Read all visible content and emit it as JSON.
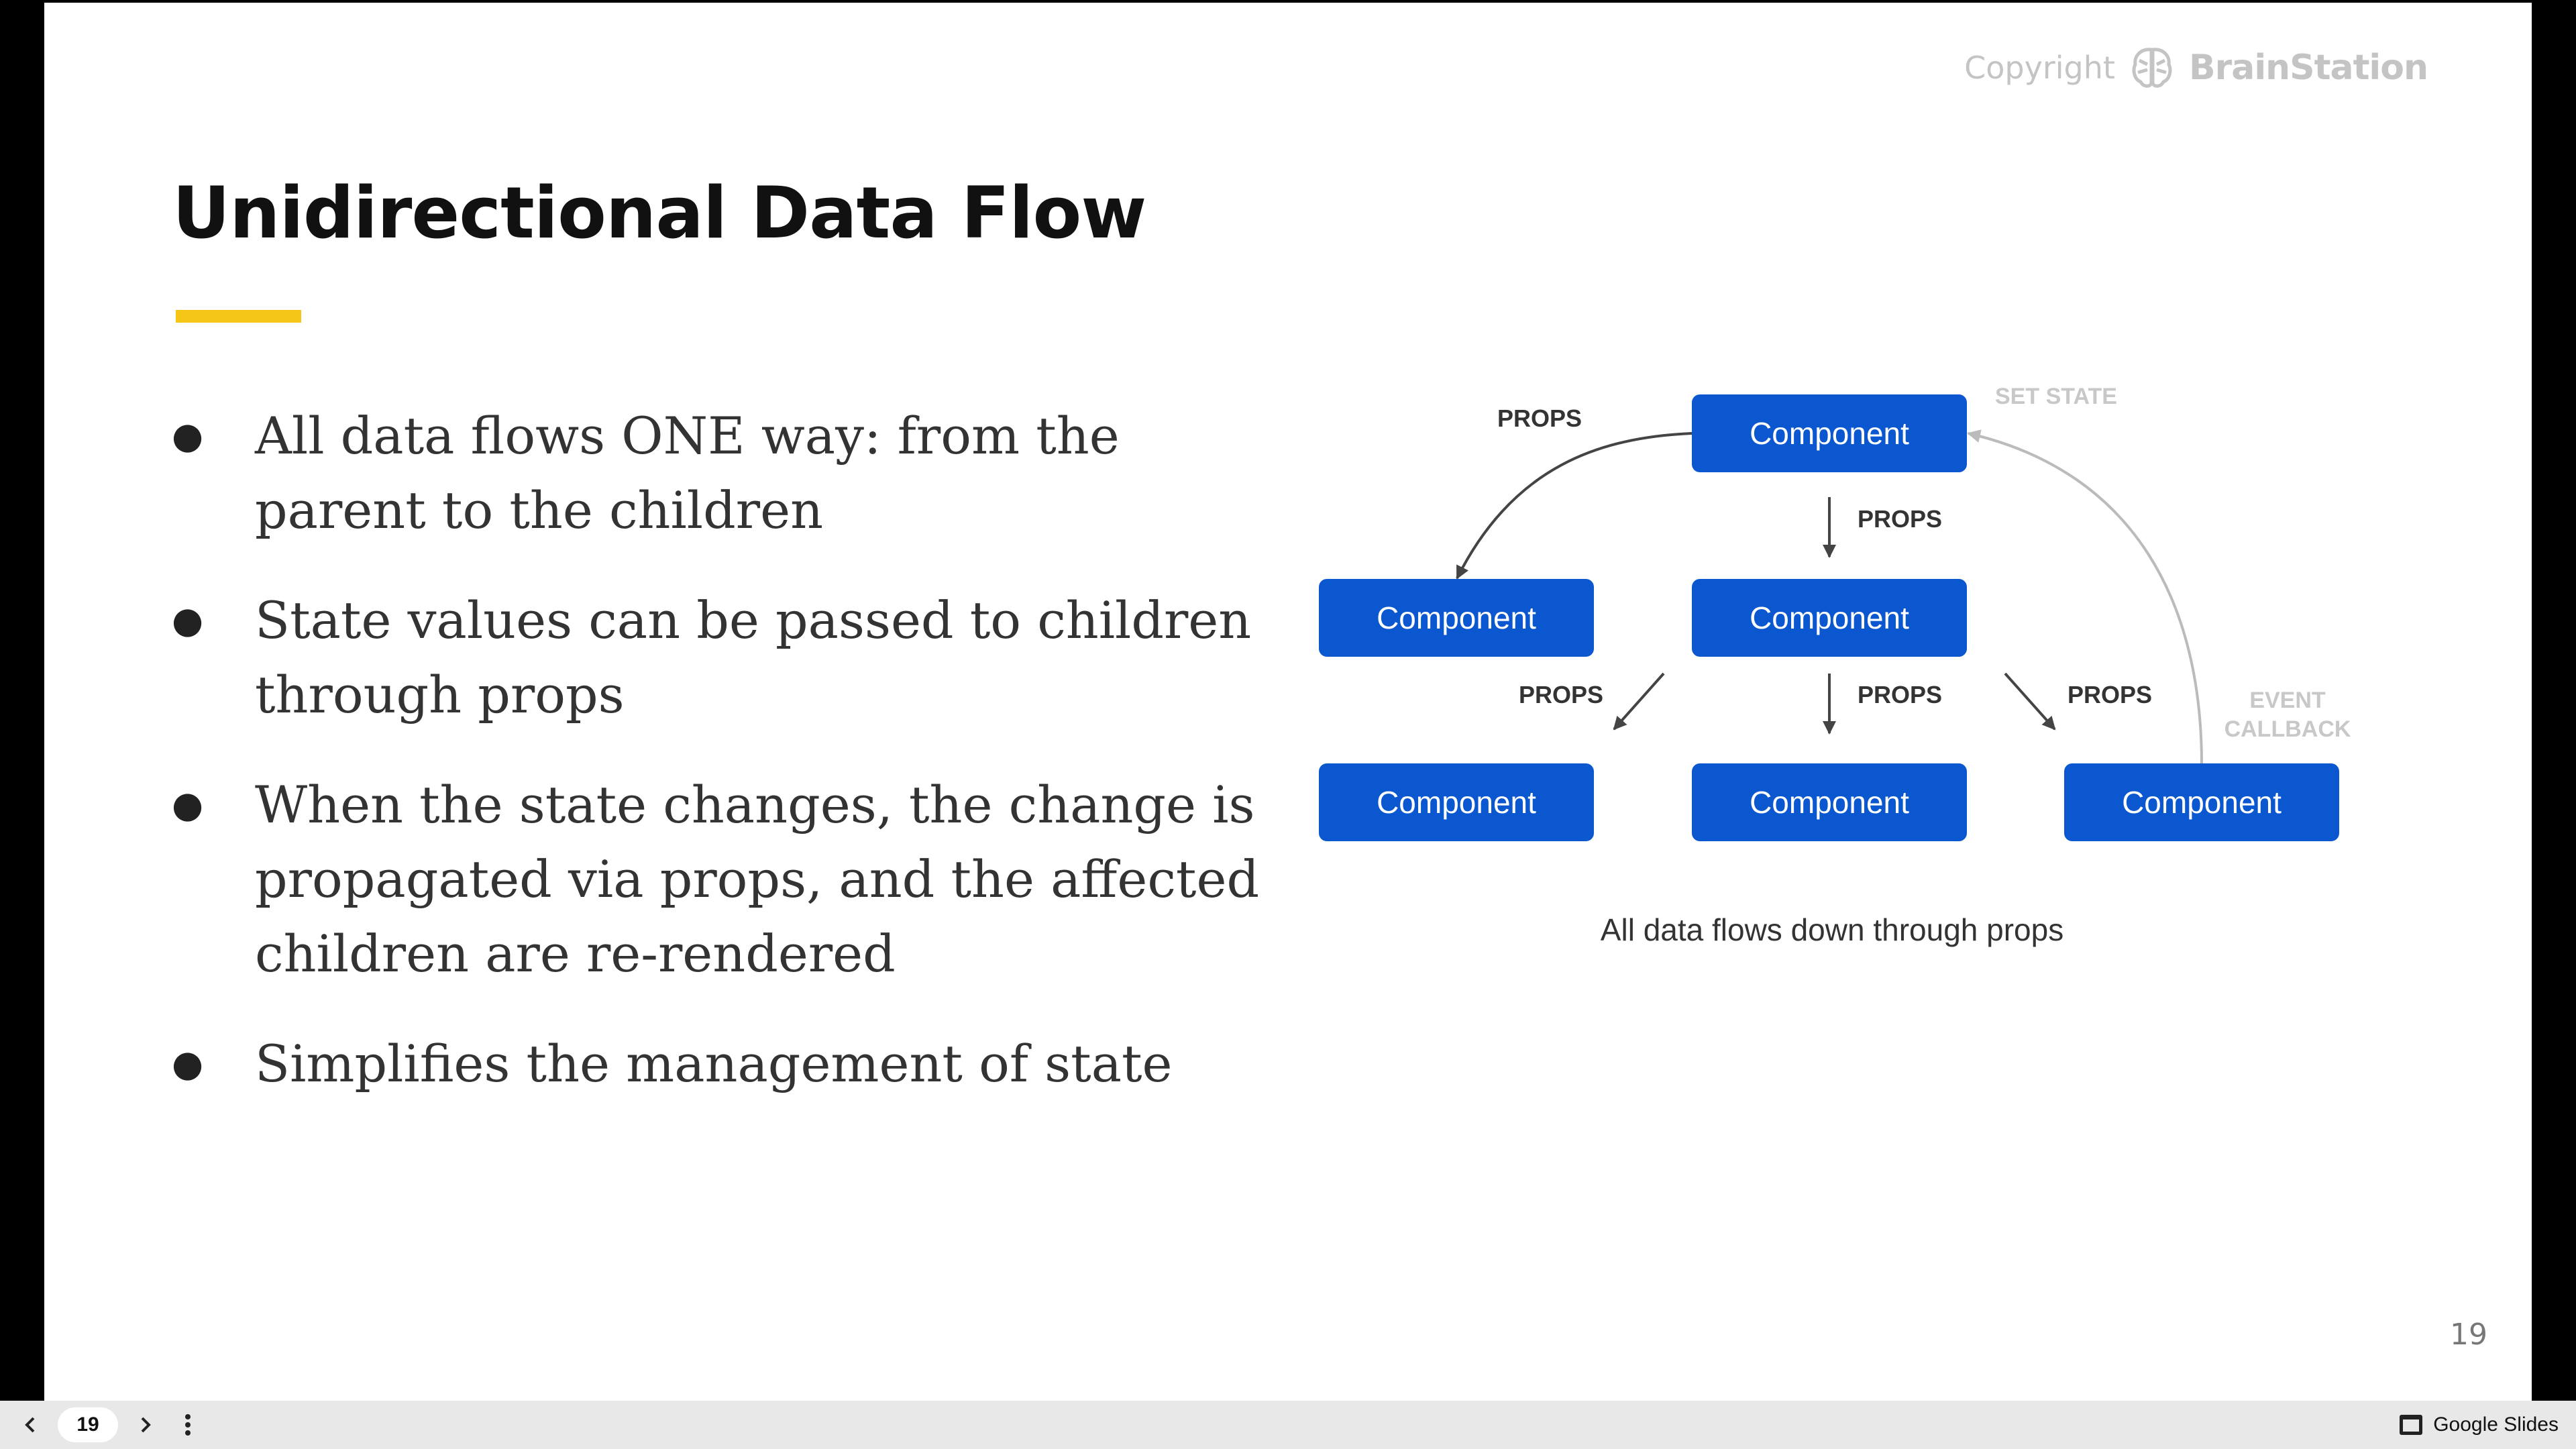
{
  "slide": {
    "title": "Unidirectional Data Flow",
    "copyright": "Copyright",
    "brand": "BrainStation",
    "number": "19",
    "accent_color": "#f5c518",
    "bullets": [
      {
        "lines": [
          "All data flows ONE way: from the",
          "parent to the children"
        ]
      },
      {
        "lines": [
          "State values can be passed to children",
          "through props"
        ]
      },
      {
        "lines": [
          "When the state changes, the change is",
          "propagated via props, and the affected",
          "children are re-rendered"
        ]
      },
      {
        "lines": [
          "Simplifies the management of state"
        ]
      }
    ]
  },
  "diagram": {
    "node_label": "Component",
    "node_color": "#0b57d0",
    "props_label": "PROPS",
    "set_state_label": "SET STATE",
    "event_callback_lines": [
      "EVENT",
      "CALLBACK"
    ],
    "caption": "All data flows down through props"
  },
  "toolbar": {
    "current_slide": "19",
    "app_name": "Google Slides",
    "prev_icon": "chevron-left-icon",
    "next_icon": "chevron-right-icon",
    "more_icon": "more-vert-icon"
  }
}
